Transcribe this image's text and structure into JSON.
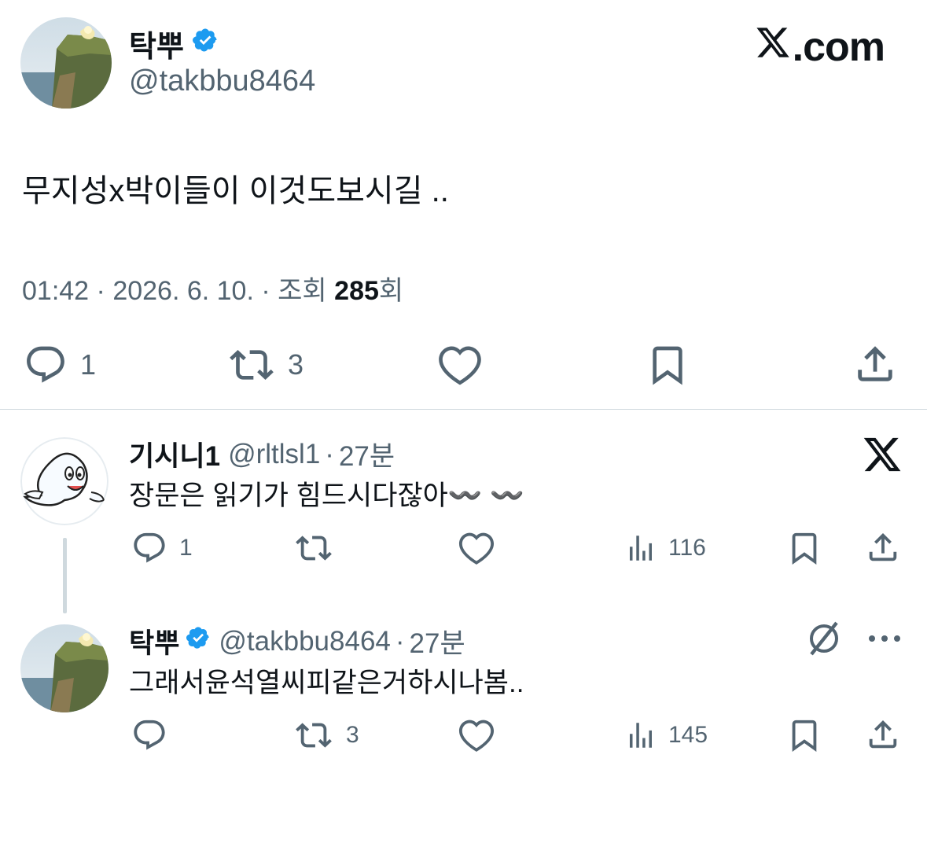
{
  "main_tweet": {
    "author_name": "탁뿌",
    "handle": "@takbbu8464",
    "text": "무지성x박이들이 이것도보시길 ..",
    "time": "01:42",
    "date": "2026. 6. 10.",
    "views_label": "조회",
    "views": "285",
    "views_suffix": "회",
    "separator": " · ",
    "actions": {
      "reply_count": "1",
      "retweet_count": "3"
    }
  },
  "brand": {
    "logo_text": ".com"
  },
  "replies": [
    {
      "author_name": "기시니1",
      "handle": "@rltlsl1",
      "time": "27분",
      "text": "장문은 읽기가 힘드시다잖아〰️ 〰️",
      "reply_count": "1",
      "retweet_count": "",
      "views": "116",
      "verified": false
    },
    {
      "author_name": "탁뿌",
      "handle": "@takbbu8464",
      "time": "27분",
      "text": "그래서윤석열씨피같은거하시나봄..",
      "reply_count": "",
      "retweet_count": "3",
      "views": "145",
      "verified": true
    }
  ],
  "colors": {
    "verified_blue": "#1d9bf0",
    "text_primary": "#0f1419",
    "text_secondary": "#536471",
    "divider": "#cfd9de"
  },
  "icons": [
    "verified-badge-icon",
    "x-logo-icon",
    "reply-icon",
    "retweet-icon",
    "like-icon",
    "bookmark-icon",
    "share-icon",
    "views-icon",
    "grok-icon",
    "more-icon"
  ]
}
